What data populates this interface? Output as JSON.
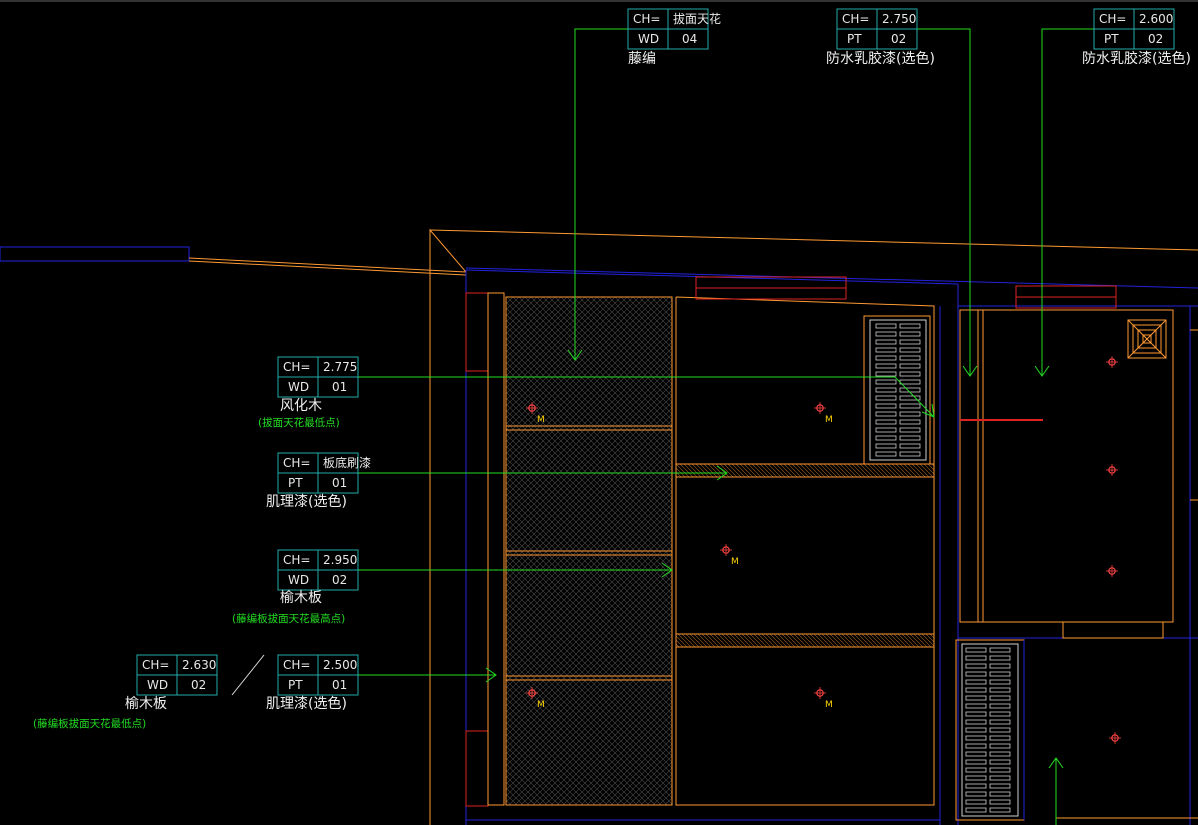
{
  "tags": [
    {
      "id": "tag-top-1",
      "r1": [
        "CH=",
        "拔面天花"
      ],
      "r2": [
        "WD",
        "04"
      ],
      "label": "藤编"
    },
    {
      "id": "tag-top-2",
      "r1": [
        "CH=",
        "2.750"
      ],
      "r2": [
        "PT",
        "02"
      ],
      "label": "防水乳胶漆(选色)"
    },
    {
      "id": "tag-top-3",
      "r1": [
        "CH=",
        "2.600"
      ],
      "r2": [
        "PT",
        "02"
      ],
      "label": "防水乳胶漆(选色)"
    },
    {
      "id": "tag-left-1",
      "r1": [
        "CH=",
        "2.775"
      ],
      "r2": [
        "WD",
        "01"
      ],
      "label": "风化木",
      "note": "(拔面天花最低点)"
    },
    {
      "id": "tag-left-2",
      "r1": [
        "CH=",
        "板底刷漆"
      ],
      "r2": [
        "PT",
        "01"
      ],
      "label": "肌理漆(选色)"
    },
    {
      "id": "tag-left-3",
      "r1": [
        "CH=",
        "2.950"
      ],
      "r2": [
        "WD",
        "02"
      ],
      "label": "榆木板",
      "note": "(藤编板拔面天花最高点)"
    },
    {
      "id": "tag-left-4",
      "r1": [
        "CH=",
        "2.630"
      ],
      "r2": [
        "WD",
        "02"
      ],
      "label": "榆木板",
      "note": "(藤编板拔面天花最低点)"
    },
    {
      "id": "tag-left-5",
      "r1": [
        "CH=",
        "2.500"
      ],
      "r2": [
        "PT",
        "01"
      ],
      "label": "肌理漆(选色)"
    }
  ],
  "light_marker": "M",
  "colors": {
    "leader": "#22dd22",
    "wall": "#ff9933",
    "grid": "#2222dd",
    "red": "#dd2222",
    "text": "#f0f0f0"
  }
}
